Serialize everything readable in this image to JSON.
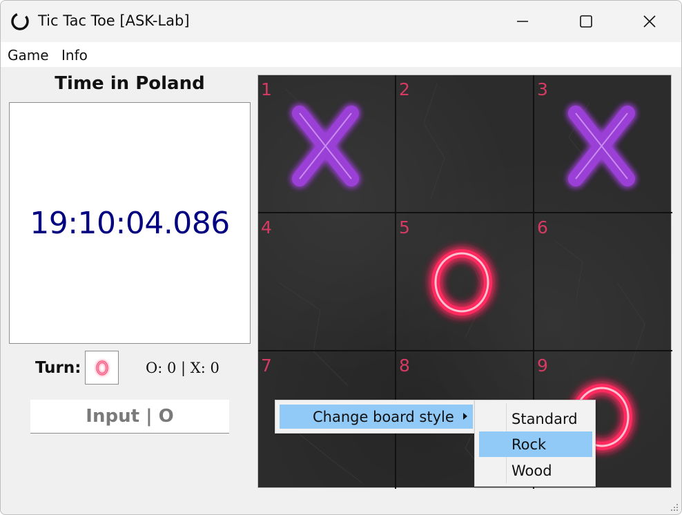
{
  "window": {
    "title": "Tic Tac Toe [ASK-Lab]",
    "controls": [
      "minimize",
      "maximize",
      "close"
    ]
  },
  "menubar": {
    "items": [
      "Game",
      "Info"
    ]
  },
  "clock": {
    "heading": "Time in Poland",
    "time": "19:10:04.086",
    "color": "#000080"
  },
  "status": {
    "turn_label": "Turn:",
    "turn_player": "O",
    "score": "O: 0 | X: 0"
  },
  "input": {
    "label": "Input | O"
  },
  "board": {
    "style": "Rock",
    "cells": [
      {
        "number": "1",
        "mark": "X"
      },
      {
        "number": "2",
        "mark": ""
      },
      {
        "number": "3",
        "mark": "X"
      },
      {
        "number": "4",
        "mark": ""
      },
      {
        "number": "5",
        "mark": "O"
      },
      {
        "number": "6",
        "mark": ""
      },
      {
        "number": "7",
        "mark": ""
      },
      {
        "number": "8",
        "mark": ""
      },
      {
        "number": "9",
        "mark": "O"
      }
    ],
    "x_color": "#a64bd9",
    "o_color": "#ff3a6b",
    "number_color": "#d63a63"
  },
  "context_menu": {
    "item": "Change board style",
    "submenu": [
      {
        "label": "Standard",
        "selected": false
      },
      {
        "label": "Rock",
        "selected": true
      },
      {
        "label": "Wood",
        "selected": false
      }
    ],
    "highlight_color": "#91c9f7"
  }
}
